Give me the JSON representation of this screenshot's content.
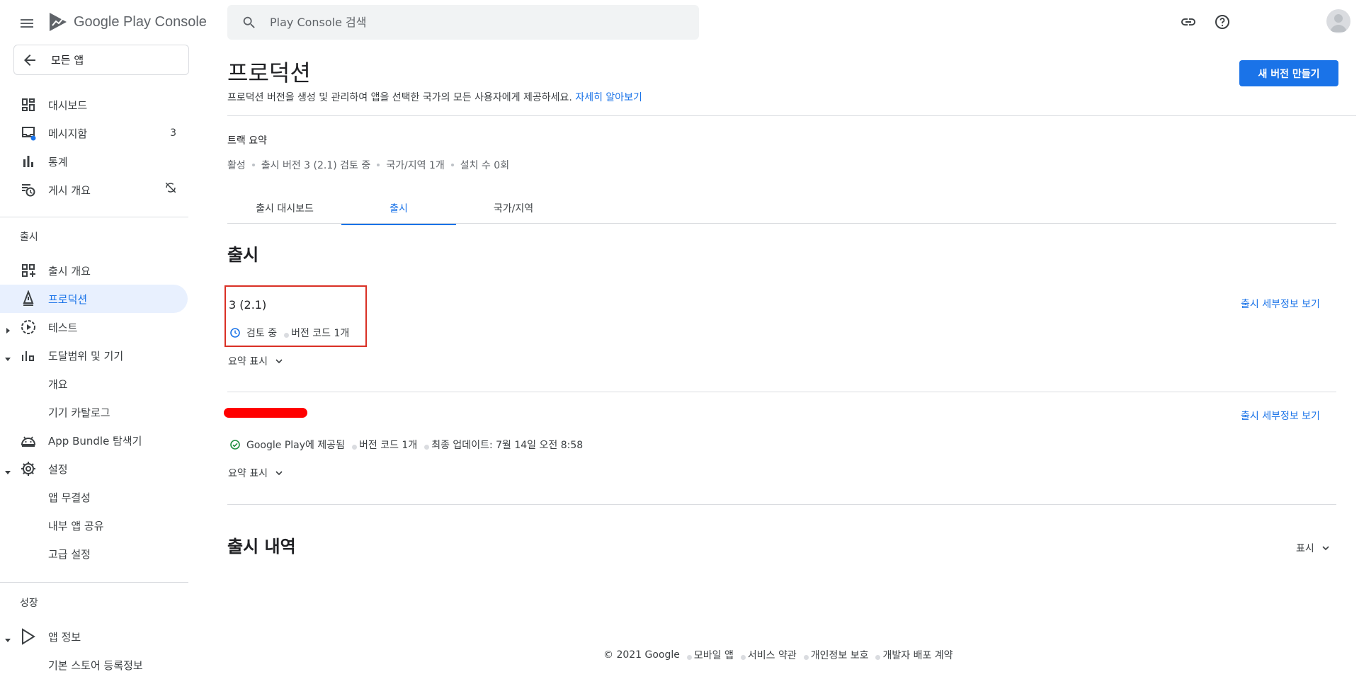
{
  "header": {
    "logo_text": "Google Play Console",
    "search_placeholder": "Play Console 검색"
  },
  "sidebar": {
    "back_label": "모든 앱",
    "top_items": [
      {
        "label": "대시보드",
        "icon": "dashboard-icon"
      },
      {
        "label": "메시지함",
        "icon": "inbox-icon",
        "count": "3"
      },
      {
        "label": "통계",
        "icon": "bar-chart-icon"
      },
      {
        "label": "게시 개요",
        "icon": "history-icon"
      }
    ],
    "section_release": "출시",
    "release_items": [
      {
        "label": "출시 개요",
        "icon": "grid-icon"
      },
      {
        "label": "프로덕션",
        "icon": "production-icon",
        "active": true
      },
      {
        "label": "테스트",
        "icon": "play-circle-icon"
      },
      {
        "label": "도달범위 및 기기",
        "icon": "reach-icon"
      },
      {
        "label": "개요"
      },
      {
        "label": "기기 카탈로그"
      },
      {
        "label": "App Bundle 탐색기",
        "icon": "android-icon"
      },
      {
        "label": "설정",
        "icon": "gear-icon"
      },
      {
        "label": "앱 무결성"
      },
      {
        "label": "내부 앱 공유"
      },
      {
        "label": "고급 설정"
      }
    ],
    "section_growth": "성장",
    "growth_items": [
      {
        "label": "앱 정보",
        "icon": "store-icon"
      },
      {
        "label": "기본 스토어 등록정보"
      }
    ]
  },
  "main": {
    "title": "프로덕션",
    "description": "프로덕션 버전을 생성 및 관리하여 앱을 선택한 국가의 모든 사용자에게 제공하세요.",
    "learn_more": "자세히 알아보기",
    "new_release_button": "새 버전 만들기",
    "track_summary_label": "트랙 요약",
    "track_summary": [
      "활성",
      "출시 버전 3 (2.1) 검토 중",
      "국가/지역 1개",
      "설치 수 0회"
    ],
    "tabs": [
      "출시 대시보드",
      "출시",
      "국가/지역"
    ],
    "active_tab": "출시",
    "releases_title": "출시",
    "releases": [
      {
        "name": "3 (2.1)",
        "status": "검토 중",
        "version_codes": "버전 코드 1개",
        "details_link": "출시 세부정보 보기",
        "summary_toggle": "요약 표시"
      },
      {
        "name": "",
        "status": "Google Play에 제공됨",
        "version_codes": "버전 코드 1개",
        "updated": "최종 업데이트: 7월 14일 오전 8:58",
        "details_link": "출시 세부정보 보기",
        "summary_toggle": "요약 표시"
      }
    ],
    "history_title": "출시 내역",
    "history_toggle": "표시"
  },
  "footer": {
    "copyright": "© 2021 Google",
    "links": [
      "모바일 앱",
      "서비스 약관",
      "개인정보 보호",
      "개발자 배포 계약"
    ]
  },
  "colors": {
    "accent": "#1a73e8",
    "active_bg": "#e8f0fe",
    "highlight": "#d93025",
    "success": "#1e8e3e",
    "redaction": "#ff0000"
  }
}
